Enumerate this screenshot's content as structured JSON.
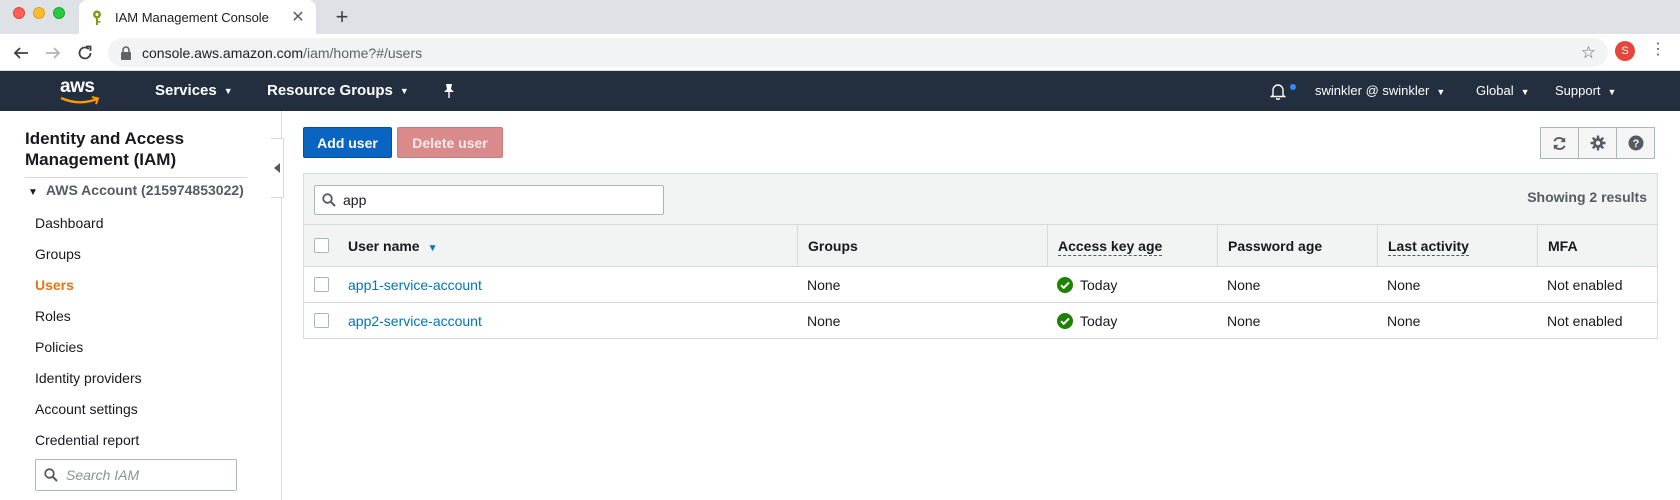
{
  "browser": {
    "tab_title": "IAM Management Console",
    "url_host": "console.aws.amazon.com",
    "url_path": "/iam/home?#/users",
    "profile_initial": "S"
  },
  "aws_nav": {
    "logo": "aws",
    "services": "Services",
    "resource_groups": "Resource Groups",
    "user": "swinkler @ swinkler",
    "region": "Global",
    "support": "Support"
  },
  "sidebar": {
    "title": "Identity and Access Management (IAM)",
    "account": "AWS Account (215974853022)",
    "items": [
      {
        "label": "Dashboard"
      },
      {
        "label": "Groups"
      },
      {
        "label": "Users"
      },
      {
        "label": "Roles"
      },
      {
        "label": "Policies"
      },
      {
        "label": "Identity providers"
      },
      {
        "label": "Account settings"
      },
      {
        "label": "Credential report"
      }
    ],
    "active": "Users",
    "search_placeholder": "Search IAM"
  },
  "actions": {
    "add_user": "Add user",
    "delete_user": "Delete user"
  },
  "filter": {
    "value": "app",
    "results": "Showing 2 results"
  },
  "table": {
    "columns": [
      "User name",
      "Groups",
      "Access key age",
      "Password age",
      "Last activity",
      "MFA"
    ],
    "rows": [
      {
        "user_name": "app1-service-account",
        "groups": "None",
        "access_key_age": "Today",
        "password_age": "None",
        "last_activity": "None",
        "mfa": "Not enabled"
      },
      {
        "user_name": "app2-service-account",
        "groups": "None",
        "access_key_age": "Today",
        "password_age": "None",
        "last_activity": "None",
        "mfa": "Not enabled"
      }
    ]
  },
  "colors": {
    "aws_nav_bg": "#232f3e",
    "primary_button": "#0a64c1",
    "active_nav": "#ec7211",
    "link": "#0073bb",
    "success": "#1d8102"
  }
}
